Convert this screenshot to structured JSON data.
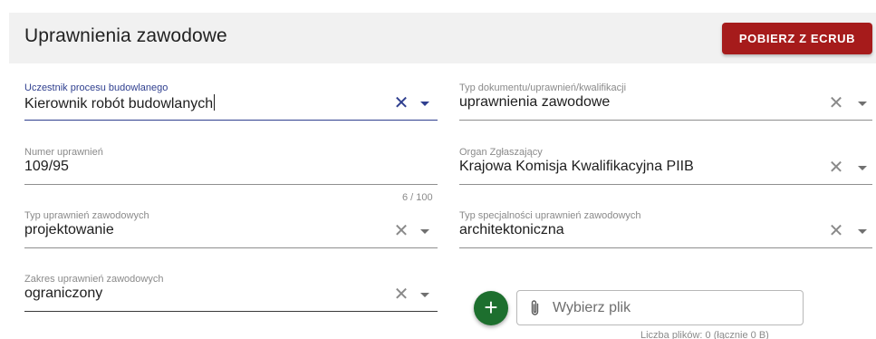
{
  "header": {
    "title": "Uprawnienia zawodowe",
    "ecrub_button": "POBIERZ Z ECRUB"
  },
  "fields": {
    "participant": {
      "label": "Uczestnik procesu budowlanego",
      "value": "Kierownik robót budowlanych"
    },
    "doc_type": {
      "label": "Typ dokumentu/uprawnień/kwalifikacji",
      "value": "uprawnienia zawodowe"
    },
    "license_number": {
      "label": "Numer uprawnień",
      "value": "109/95",
      "counter": "6 / 100"
    },
    "authority": {
      "label": "Organ Zgłaszający",
      "value": "Krajowa Komisja Kwalifikacyjna PIIB"
    },
    "license_type": {
      "label": "Typ uprawnień zawodowych",
      "value": "projektowanie"
    },
    "specialty_type": {
      "label": "Typ specjalności uprawnień zawodowych",
      "value": "architektoniczna"
    },
    "scope": {
      "label": "Zakres uprawnień zawodowych",
      "value": "ograniczony"
    }
  },
  "file_upload": {
    "placeholder": "Wybierz plik",
    "count_text": "Liczba plików: 0 (łącznie 0 B)",
    "add_symbol": "+"
  },
  "icons": {
    "clear": "close-icon",
    "dropdown": "chevron-down-icon",
    "attach": "paperclip-icon",
    "add": "plus-icon"
  },
  "colors": {
    "header_bg": "#f1f1f1",
    "ecrub_button": "#a61b1b",
    "focus_accent": "#2f3f8f",
    "add_button": "#1d6f2e"
  }
}
